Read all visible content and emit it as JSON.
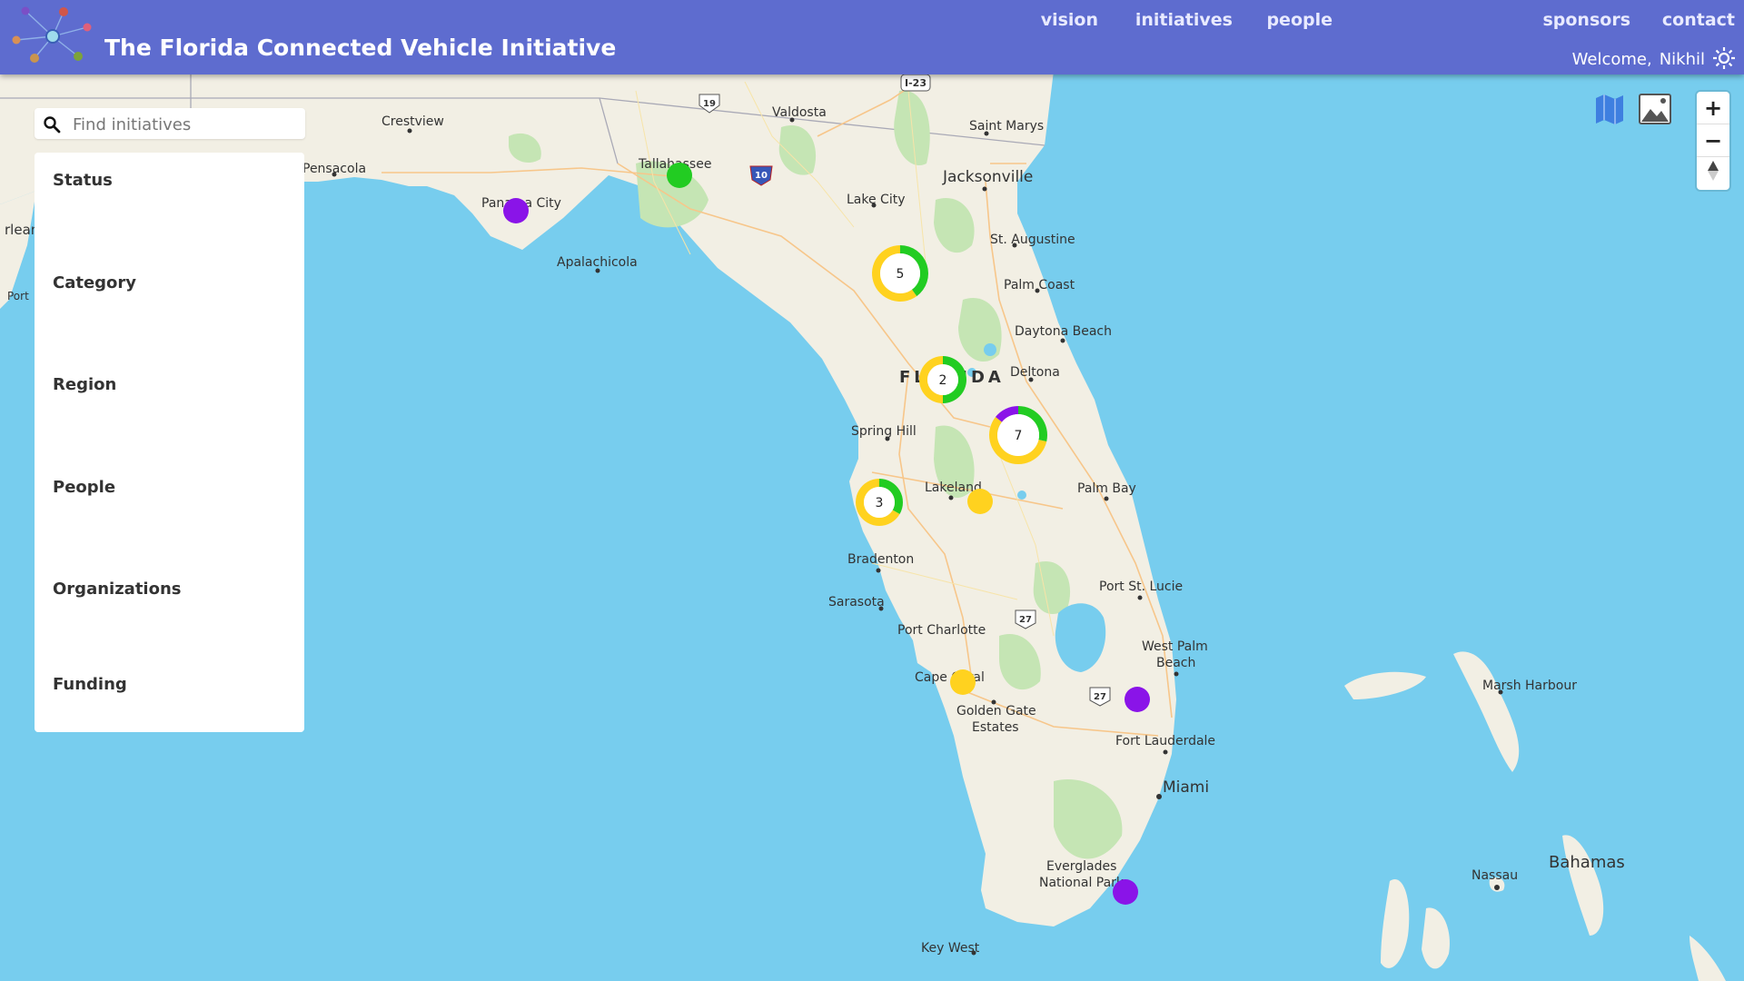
{
  "header": {
    "title": "The Florida Connected Vehicle Initiative",
    "nav": [
      {
        "label": "vision"
      },
      {
        "label": "initiatives"
      },
      {
        "label": "people"
      },
      {
        "label": "sponsors"
      },
      {
        "label": "contact"
      }
    ],
    "welcome_label": "Welcome,",
    "user_name": "Nikhil",
    "settings_icon": "gear-icon"
  },
  "search": {
    "placeholder": "Find initiatives",
    "value": ""
  },
  "filters": [
    {
      "label": "Status"
    },
    {
      "label": "Category"
    },
    {
      "label": "Region"
    },
    {
      "label": "People"
    },
    {
      "label": "Organizations"
    },
    {
      "label": "Funding"
    }
  ],
  "map_controls": {
    "zoom_in": "+",
    "zoom_out": "−",
    "layer_buttons": [
      "map-layer-icon",
      "satellite-layer-icon"
    ],
    "reset_north": "compass-icon"
  },
  "colors": {
    "header": "#5e6ccf",
    "water": "#77cdee",
    "land": "#f2efe4",
    "status_green": "#22cc22",
    "status_yellow": "#ffd21f",
    "status_purple": "#8a14e8"
  },
  "map_labels": [
    "Crestview",
    "Pensacola",
    "Panama City",
    "Apalachicola",
    "Tallahassee",
    "Valdosta",
    "Saint Marys",
    "Jacksonville",
    "Lake City",
    "St. Augustine",
    "Palm Coast",
    "Daytona Beach",
    "Deltona",
    "FLORIDA",
    "Spring Hill",
    "Lakeland",
    "Palm Bay",
    "Bradenton",
    "Sarasota",
    "Port St. Lucie",
    "Port Charlotte",
    "West Palm Beach",
    "Cape Coral",
    "Golden Gate Estates",
    "Fort Lauderdale",
    "Miami",
    "Everglades National Park",
    "Key West",
    "Nassau",
    "Bahamas",
    "Marsh Harbour",
    "I-23",
    "19",
    "10",
    "27"
  ],
  "clusters": [
    {
      "count": "5",
      "segments": [
        {
          "status": "green",
          "count": 2
        },
        {
          "status": "yellow",
          "count": 3
        }
      ]
    },
    {
      "count": "2",
      "segments": [
        {
          "status": "green",
          "count": 1
        },
        {
          "status": "yellow",
          "count": 1
        }
      ]
    },
    {
      "count": "7",
      "segments": [
        {
          "status": "green",
          "count": 2
        },
        {
          "status": "yellow",
          "count": 4
        },
        {
          "status": "purple",
          "count": 1
        }
      ]
    },
    {
      "count": "3",
      "segments": [
        {
          "status": "green",
          "count": 1
        },
        {
          "status": "yellow",
          "count": 2
        }
      ]
    }
  ],
  "markers": [
    {
      "status": "green"
    },
    {
      "status": "purple"
    },
    {
      "status": "yellow"
    },
    {
      "status": "yellow"
    },
    {
      "status": "purple"
    },
    {
      "status": "purple"
    }
  ]
}
